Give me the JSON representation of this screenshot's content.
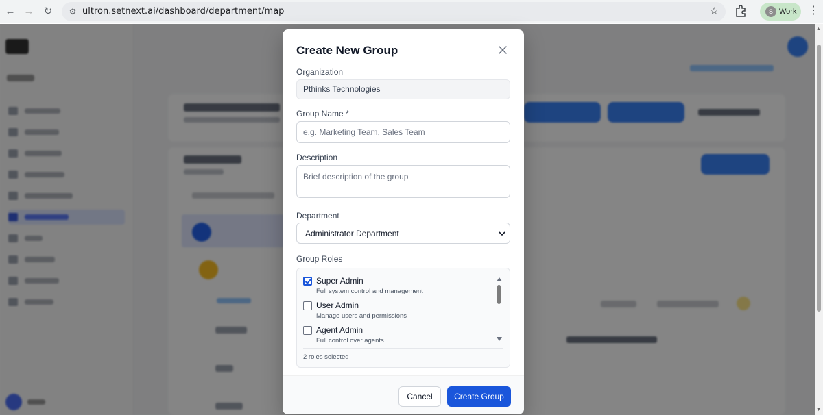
{
  "browser": {
    "url": "ultron.setnext.ai/dashboard/department/map",
    "profile_initial": "S",
    "profile_label": "Work"
  },
  "modal": {
    "title": "Create New Group",
    "organization": {
      "label": "Organization",
      "value": "Pthinks Technologies"
    },
    "group_name": {
      "label": "Group Name *",
      "placeholder": "e.g. Marketing Team, Sales Team",
      "value": ""
    },
    "description": {
      "label": "Description",
      "placeholder": "Brief description of the group",
      "value": ""
    },
    "department": {
      "label": "Department",
      "selected": "Administrator Department"
    },
    "group_roles": {
      "label": "Group Roles",
      "roles": [
        {
          "name": "Super Admin",
          "description": "Full system control and management",
          "checked": true
        },
        {
          "name": "User Admin",
          "description": "Manage users and permissions",
          "checked": false
        },
        {
          "name": "Agent Admin",
          "description": "Full control over agents",
          "checked": false
        }
      ],
      "selected_count_text": "2 roles selected"
    },
    "buttons": {
      "cancel": "Cancel",
      "create": "Create Group"
    }
  },
  "colors": {
    "primary": "#1a56db",
    "overlay": "rgba(0,0,0,0.48)"
  }
}
